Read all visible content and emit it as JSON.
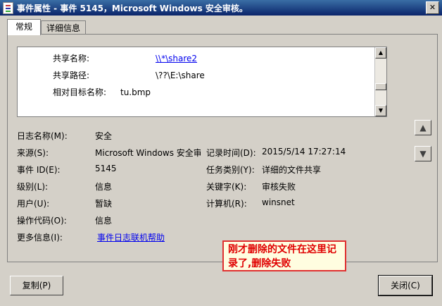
{
  "window": {
    "title": "事件属性 - 事件 5145，Microsoft Windows 安全审核。",
    "close_glyph": "✕"
  },
  "tabs": [
    {
      "label": "常规"
    },
    {
      "label": "详细信息"
    }
  ],
  "details_box": {
    "rows": [
      {
        "label": "共享名称:",
        "value": "\\\\*\\share2"
      },
      {
        "label": "共享路径:",
        "value": "\\??\\E:\\share"
      },
      {
        "label": "相对目标名称:",
        "value": "tu.bmp"
      }
    ]
  },
  "fields": {
    "log_name": {
      "label": "日志名称(M):",
      "value": "安全"
    },
    "source": {
      "label": "来源(S):",
      "value": "Microsoft Windows 安全审"
    },
    "logged": {
      "label": "记录时间(D):",
      "value": "2015/5/14 17:27:14"
    },
    "event_id": {
      "label": "事件 ID(E):",
      "value": "5145"
    },
    "task_category": {
      "label": "任务类别(Y):",
      "value": "详细的文件共享"
    },
    "level": {
      "label": "级别(L):",
      "value": "信息"
    },
    "keywords": {
      "label": "关键字(K):",
      "value": "审核失败"
    },
    "user": {
      "label": "用户(U):",
      "value": "暂缺"
    },
    "computer": {
      "label": "计算机(R):",
      "value": "winsnet"
    },
    "opcode": {
      "label": "操作代码(O):",
      "value": "信息"
    },
    "more_info": {
      "label": "更多信息(I):",
      "link": "事件日志联机帮助"
    }
  },
  "annotation": {
    "text": "刚才删除的文件在这里记录了,删除失败"
  },
  "buttons": {
    "copy": "复制(P)",
    "close": "关闭(C)"
  },
  "icons": {
    "up": "arrow-up-icon",
    "down": "arrow-down-icon"
  }
}
